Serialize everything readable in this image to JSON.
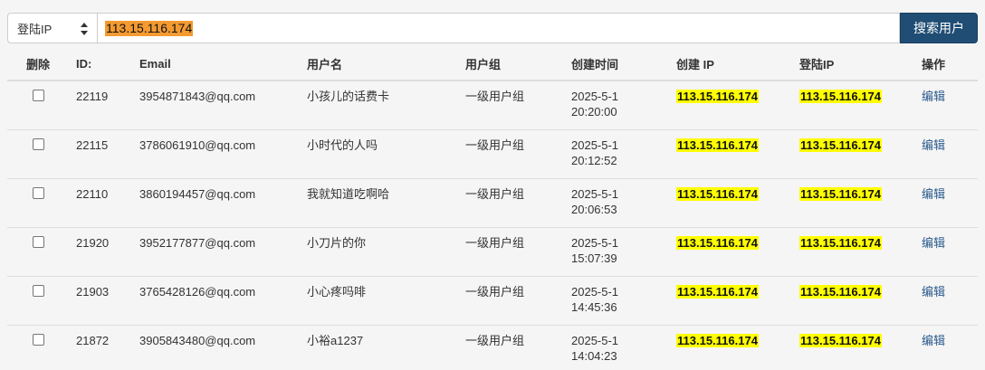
{
  "search": {
    "select_value": "登陆IP",
    "query": "113.15.116.174",
    "button_label": "搜索用户"
  },
  "columns": {
    "delete": "删除",
    "id": "ID:",
    "email": "Email",
    "username": "用户名",
    "group": "用户组",
    "created_time": "创建时间",
    "created_ip": "创建 IP",
    "login_ip": "登陆IP",
    "actions": "操作"
  },
  "rows": [
    {
      "id": "22119",
      "email": "3954871843@qq.com",
      "username": "小孩儿的话费卡",
      "group": "一级用户组",
      "date": "2025-5-1",
      "time": "20:20:00",
      "created_ip": "113.15.116.174",
      "login_ip": "113.15.116.174",
      "action": "编辑"
    },
    {
      "id": "22115",
      "email": "3786061910@qq.com",
      "username": "小时代的人吗",
      "group": "一级用户组",
      "date": "2025-5-1",
      "time": "20:12:52",
      "created_ip": "113.15.116.174",
      "login_ip": "113.15.116.174",
      "action": "编辑"
    },
    {
      "id": "22110",
      "email": "3860194457@qq.com",
      "username": "我就知道吃啊哈",
      "group": "一级用户组",
      "date": "2025-5-1",
      "time": "20:06:53",
      "created_ip": "113.15.116.174",
      "login_ip": "113.15.116.174",
      "action": "编辑"
    },
    {
      "id": "21920",
      "email": "3952177877@qq.com",
      "username": "小刀片的你",
      "group": "一级用户组",
      "date": "2025-5-1",
      "time": "15:07:39",
      "created_ip": "113.15.116.174",
      "login_ip": "113.15.116.174",
      "action": "编辑"
    },
    {
      "id": "21903",
      "email": "3765428126@qq.com",
      "username": "小心疼吗啡",
      "group": "一级用户组",
      "date": "2025-5-1",
      "time": "14:45:36",
      "created_ip": "113.15.116.174",
      "login_ip": "113.15.116.174",
      "action": "编辑"
    },
    {
      "id": "21872",
      "email": "3905843480@qq.com",
      "username": "小裕a1237",
      "group": "一级用户组",
      "date": "2025-5-1",
      "time": "14:04:23",
      "created_ip": "113.15.116.174",
      "login_ip": "113.15.116.174",
      "action": "编辑"
    }
  ]
}
